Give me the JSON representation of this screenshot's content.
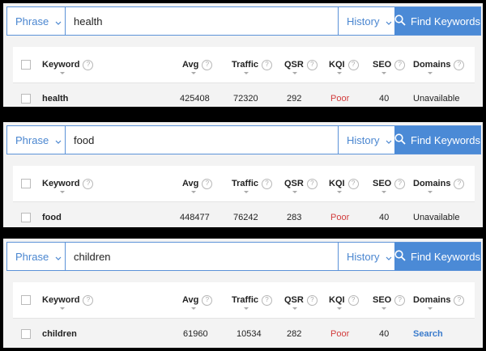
{
  "panels": [
    {
      "mode": "Phrase",
      "query": "health",
      "history_label": "History",
      "find_label": "Find Keywords",
      "headers": [
        "Keyword",
        "Avg",
        "Traffic",
        "QSR",
        "KQI",
        "SEO",
        "Domains"
      ],
      "row": {
        "keyword": "health",
        "avg": "425408",
        "traffic": "72320",
        "qsr": "292",
        "kqi": "Poor",
        "seo": "40",
        "domains": "Unavailable"
      }
    },
    {
      "mode": "Phrase",
      "query": "food",
      "history_label": "History",
      "find_label": "Find Keywords",
      "headers": [
        "Keyword",
        "Avg",
        "Traffic",
        "QSR",
        "KQI",
        "SEO",
        "Domains"
      ],
      "row": {
        "keyword": "food",
        "avg": "448477",
        "traffic": "76242",
        "qsr": "283",
        "kqi": "Poor",
        "seo": "40",
        "domains": "Unavailable"
      }
    },
    {
      "mode": "Phrase",
      "query": "children",
      "history_label": "History",
      "find_label": "Find Keywords",
      "headers": [
        "Keyword",
        "Avg",
        "Traffic",
        "QSR",
        "KQI",
        "SEO",
        "Domains"
      ],
      "row": {
        "keyword": "children",
        "avg": "61960",
        "traffic": "10534",
        "qsr": "282",
        "kqi": "Poor",
        "seo": "40",
        "domains": "Search"
      }
    }
  ],
  "colors": {
    "accent": "#4b8ad6",
    "poor": "#d23c3c",
    "link": "#3b7ccc"
  },
  "icons": {
    "search": "magnifier-icon",
    "dropdown": "chevron-down-icon",
    "help": "question-circle-icon"
  }
}
